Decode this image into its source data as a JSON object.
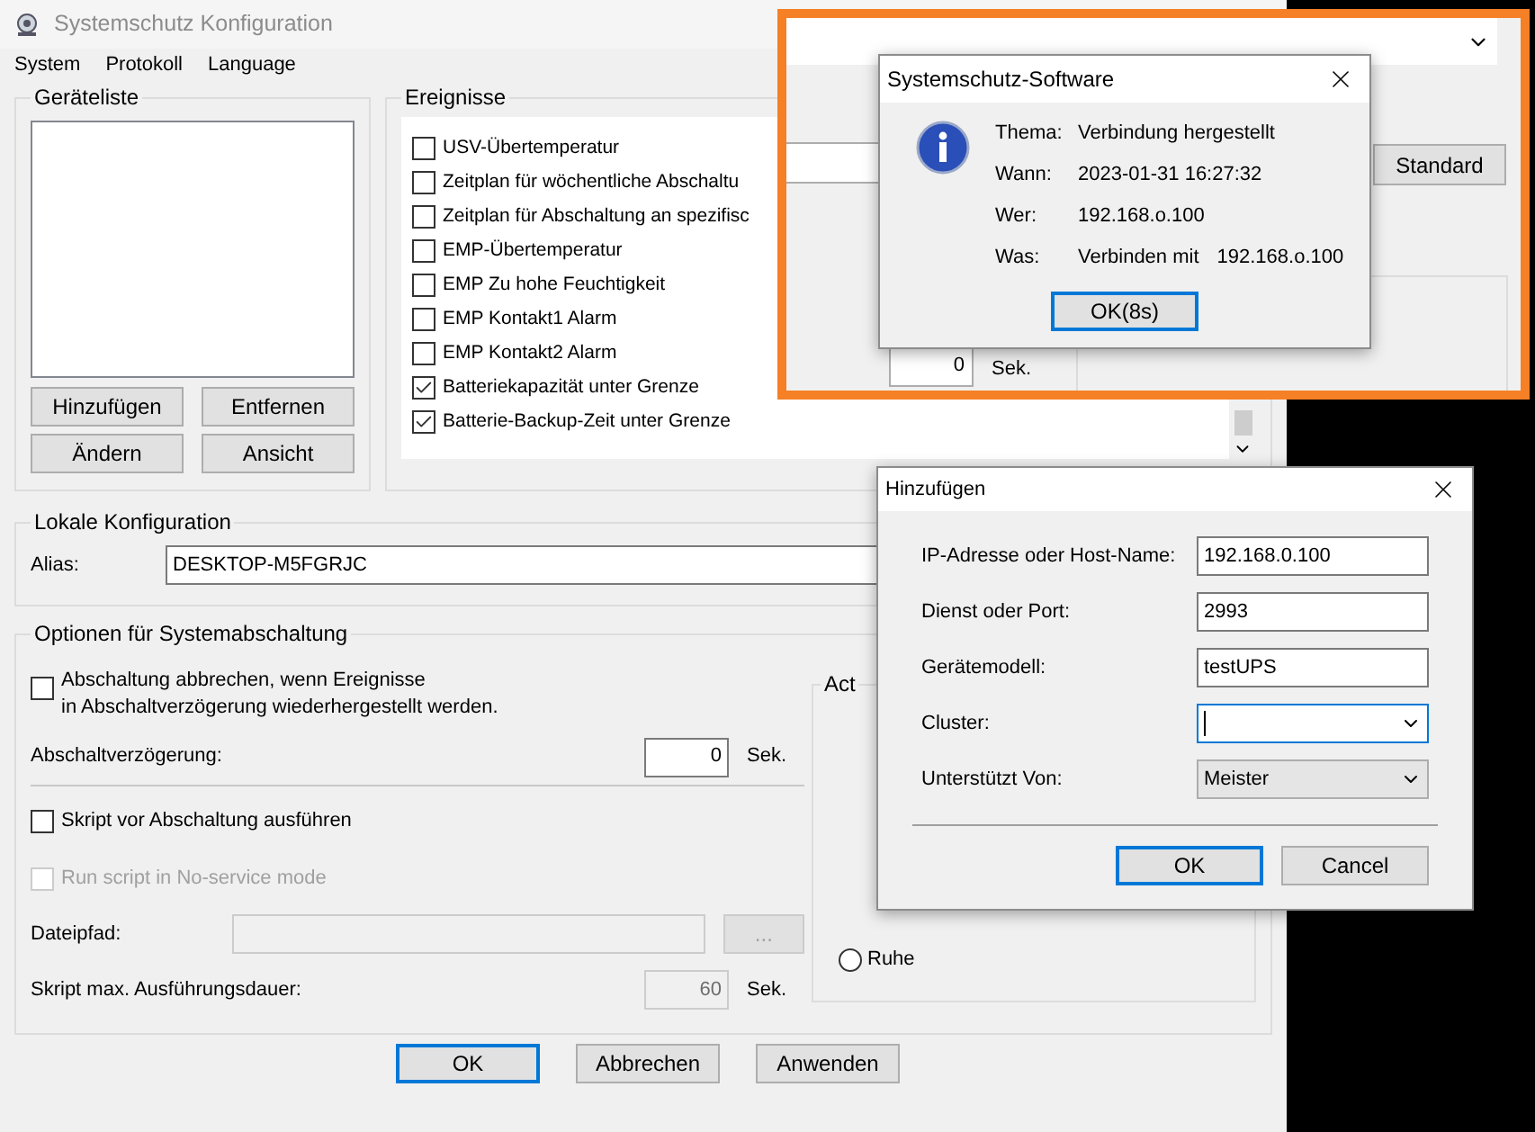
{
  "window": {
    "title": "Systemschutz Konfiguration"
  },
  "menu": [
    "System",
    "Protokoll",
    "Language"
  ],
  "device_list": {
    "title": "Geräteliste",
    "buttons": [
      "Hinzufügen",
      "Entfernen",
      "Ändern",
      "Ansicht"
    ]
  },
  "events": {
    "title": "Ereignisse",
    "items": [
      {
        "label": "USV-Übertemperatur",
        "checked": false
      },
      {
        "label": "Zeitplan für wöchentliche Abschaltu",
        "checked": false
      },
      {
        "label": "Zeitplan für Abschaltung an spezifisc",
        "checked": false
      },
      {
        "label": "EMP-Übertemperatur",
        "checked": false
      },
      {
        "label": "EMP Zu hohe Feuchtigkeit",
        "checked": false
      },
      {
        "label": "EMP Kontakt1 Alarm",
        "checked": false
      },
      {
        "label": "EMP Kontakt2 Alarm",
        "checked": false
      },
      {
        "label": "Batteriekapazität unter Grenze",
        "checked": true
      },
      {
        "label": "Batterie-Backup-Zeit unter Grenze",
        "checked": true
      }
    ]
  },
  "local_config": {
    "title": "Lokale Konfiguration",
    "alias_label": "Alias:",
    "alias_value": "DESKTOP-M5FGRJC"
  },
  "shutdown_options": {
    "title": "Optionen für Systemabschaltung",
    "cancel_on_restore": {
      "label": "Abschaltung abbrechen, wenn Ereignisse\n in Abschaltverzögerung wiederhergestellt werden.",
      "checked": false
    },
    "delay": {
      "label": "Abschaltverzögerung:",
      "value": "0",
      "unit": "Sek."
    },
    "run_script": {
      "label": "Skript vor Abschaltung ausführen",
      "checked": false
    },
    "no_service": {
      "label": "Run script in No-service mode",
      "checked": false,
      "disabled": true
    },
    "file_path": {
      "label": "Dateipfad:",
      "browse": "...",
      "disabled": true
    },
    "max_duration": {
      "label": "Skript max. Ausführungsdauer:",
      "value": "60",
      "unit": "Sek.",
      "disabled": true
    },
    "action": {
      "title": "Act",
      "options": [
        {
          "label": "Ruhe",
          "selected": false
        }
      ]
    }
  },
  "footer_buttons": [
    {
      "label": "OK",
      "default": true
    },
    {
      "label": "Abbrechen",
      "default": false
    },
    {
      "label": "Anwenden",
      "default": false
    }
  ],
  "inset": {
    "standard_button": "Standard",
    "delay_value": "0",
    "delay_unit": "Sek.",
    "message_box": {
      "title": "Systemschutz-Software",
      "rows": [
        {
          "label": "Thema:",
          "value": "Verbindung hergestellt"
        },
        {
          "label": "Wann:",
          "value": "2023-01-31 16:27:32"
        },
        {
          "label": "Wer:",
          "value": "192.168.o.100"
        },
        {
          "label": "Was:",
          "value": "Verbinden mit",
          "extra": "192.168.o.100"
        }
      ],
      "button": {
        "label": "OK(8s)",
        "default": true
      }
    }
  },
  "add_dialog": {
    "title": "Hinzufügen",
    "fields": [
      {
        "kind": "text",
        "label": "IP-Adresse oder Host-Name:",
        "value": "192.168.0.100",
        "focused": false
      },
      {
        "kind": "text",
        "label": "Dienst oder Port:",
        "value": "2993",
        "focused": false
      },
      {
        "kind": "text",
        "label": "Gerätemodell:",
        "value": "testUPS",
        "focused": false
      },
      {
        "kind": "combo",
        "label": "Cluster:",
        "focused": true
      },
      {
        "kind": "dropdown",
        "label": "Unterstützt Von:",
        "value": "Meister",
        "focused": false
      }
    ],
    "buttons": [
      {
        "label": "OK",
        "default": true
      },
      {
        "label": "Cancel",
        "default": false
      }
    ]
  }
}
